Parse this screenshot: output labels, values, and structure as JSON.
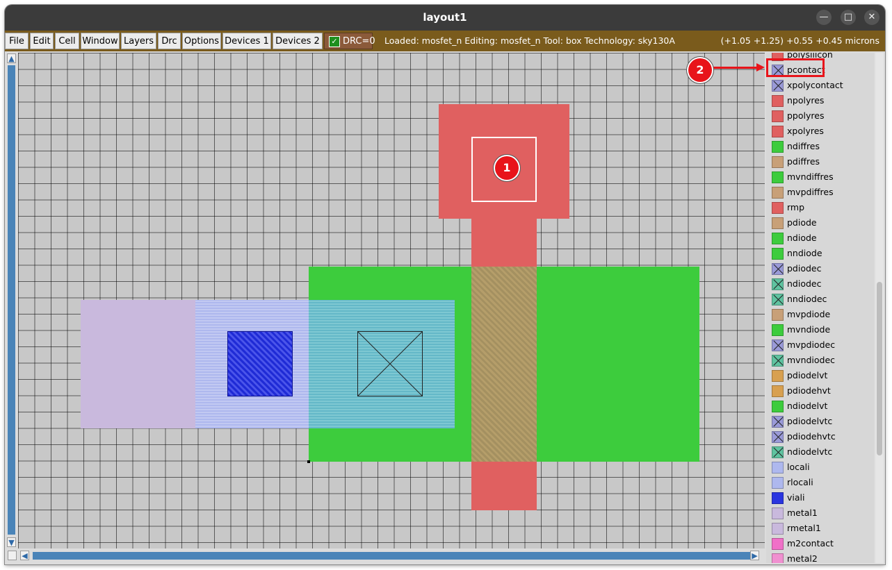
{
  "window": {
    "title": "layout1"
  },
  "menu": [
    {
      "label": "File"
    },
    {
      "label": "Edit"
    },
    {
      "label": "Cell"
    },
    {
      "label": "Window"
    },
    {
      "label": "Layers"
    },
    {
      "label": "Drc"
    },
    {
      "label": "Options"
    },
    {
      "label": "Devices 1"
    },
    {
      "label": "Devices 2"
    }
  ],
  "drc": {
    "label": "DRC=0",
    "checked": true
  },
  "status": {
    "text": "Loaded: mosfet_n Editing: mosfet_n Tool: box  Technology: sky130A",
    "coords": "(+1.05 +1.25) +0.55 +0.45 microns"
  },
  "markers": {
    "one": "1",
    "two": "2"
  },
  "icons": {
    "minimize": "—",
    "maximize": "□",
    "close": "✕",
    "up": "▲",
    "down": "▼",
    "left": "◀",
    "right": "▶",
    "check": "✓"
  },
  "layers": [
    {
      "name": "polysilicon",
      "color": "#e06060",
      "contact": false
    },
    {
      "name": "pcontact",
      "color": "#9a9ad8",
      "contact": true
    },
    {
      "name": "xpolycontact",
      "color": "#9a9ad8",
      "contact": true
    },
    {
      "name": "npolyres",
      "color": "#e06060",
      "contact": false
    },
    {
      "name": "ppolyres",
      "color": "#e06060",
      "contact": false
    },
    {
      "name": "xpolyres",
      "color": "#e06060",
      "contact": false
    },
    {
      "name": "ndiffres",
      "color": "#3dcc3d",
      "contact": false
    },
    {
      "name": "pdiffres",
      "color": "#c8a078",
      "contact": false
    },
    {
      "name": "mvndiffres",
      "color": "#3dcc3d",
      "contact": false
    },
    {
      "name": "mvpdiffres",
      "color": "#c8a078",
      "contact": false
    },
    {
      "name": "rmp",
      "color": "#e06060",
      "contact": false
    },
    {
      "name": "pdiode",
      "color": "#c8a078",
      "contact": false
    },
    {
      "name": "ndiode",
      "color": "#3dcc3d",
      "contact": false
    },
    {
      "name": "nndiode",
      "color": "#3dcc3d",
      "contact": false
    },
    {
      "name": "pdiodec",
      "color": "#9a9ad8",
      "contact": true
    },
    {
      "name": "ndiodec",
      "color": "#5fc3a0",
      "contact": true
    },
    {
      "name": "nndiodec",
      "color": "#5fc3a0",
      "contact": true
    },
    {
      "name": "mvpdiode",
      "color": "#c8a078",
      "contact": false
    },
    {
      "name": "mvndiode",
      "color": "#3dcc3d",
      "contact": false
    },
    {
      "name": "mvpdiodec",
      "color": "#9a9ad8",
      "contact": true
    },
    {
      "name": "mvndiodec",
      "color": "#5fc3a0",
      "contact": true
    },
    {
      "name": "pdiodelvt",
      "color": "#d8a050",
      "contact": false
    },
    {
      "name": "pdiodehvt",
      "color": "#d8a050",
      "contact": false
    },
    {
      "name": "ndiodelvt",
      "color": "#3dcc3d",
      "contact": false
    },
    {
      "name": "pdiodelvtc",
      "color": "#9a9ad8",
      "contact": true
    },
    {
      "name": "pdiodehvtc",
      "color": "#9a9ad8",
      "contact": true
    },
    {
      "name": "ndiodelvtc",
      "color": "#5fc3a0",
      "contact": true
    },
    {
      "name": "locali",
      "color": "#aeb8ee",
      "contact": false
    },
    {
      "name": "rlocali",
      "color": "#aeb8ee",
      "contact": false
    },
    {
      "name": "viali",
      "color": "#2a35e0",
      "contact": false
    },
    {
      "name": "metal1",
      "color": "#c9b9dd",
      "contact": false
    },
    {
      "name": "rmetal1",
      "color": "#c9b9dd",
      "contact": false
    },
    {
      "name": "m2contact",
      "color": "#f070c8",
      "contact": false
    },
    {
      "name": "metal2",
      "color": "#f090d0",
      "contact": false
    }
  ]
}
